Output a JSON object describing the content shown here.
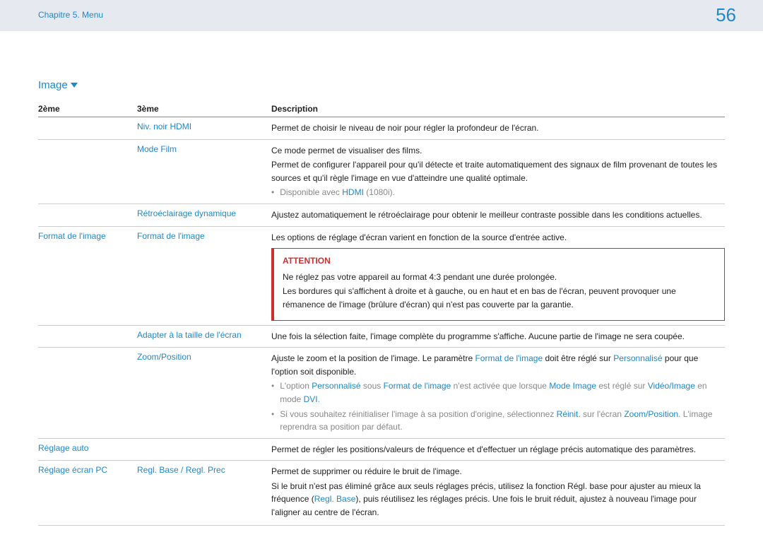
{
  "header": {
    "chapter": "Chapitre 5. Menu",
    "page": "56"
  },
  "section": {
    "title": "Image"
  },
  "table": {
    "headers": {
      "col2": "2ème",
      "col3": "3ème",
      "desc": "Description"
    }
  },
  "rows": {
    "r1": {
      "col3": "Niv. noir HDMI",
      "desc": "Permet de choisir le niveau de noir pour régler la profondeur de l'écran."
    },
    "r2": {
      "col3": "Mode Film",
      "p1": "Ce mode permet de visualiser des films.",
      "p2": "Permet de configurer l'appareil pour qu'il détecte et traite automatiquement des signaux de film provenant de toutes les sources et qu'il règle l'image en vue d'atteindre une qualité optimale.",
      "bullet_pre": "Disponible avec ",
      "bullet_link": "HDMI",
      "bullet_post": " (1080i)."
    },
    "r3": {
      "col3": "Rétroéclairage dynamique",
      "desc": "Ajustez automatiquement le rétroéclairage pour obtenir le meilleur contraste possible dans les conditions actuelles."
    },
    "r4": {
      "col2": "Format de l'image",
      "col3": "Format de l'image",
      "p1": "Les options de réglage d'écran varient en fonction de la source d'entrée active.",
      "attention": {
        "title": "ATTENTION",
        "l1": "Ne réglez pas votre appareil au format 4:3 pendant une durée prolongée.",
        "l2": "Les bordures qui s'affichent à droite et à gauche, ou en haut et en bas de l'écran, peuvent provoquer une rémanence de l'image (brûlure d'écran) qui n'est pas couverte par la garantie."
      }
    },
    "r5": {
      "col3": "Adapter à la taille de l'écran",
      "desc": "Une fois la sélection faite, l'image complète du programme s'affiche. Aucune partie de l'image ne sera coupée."
    },
    "r6": {
      "col3": "Zoom/Position",
      "p1a": "Ajuste le zoom et la position de l'image. Le paramètre ",
      "p1b": "Format de l'image",
      "p1c": " doit être réglé sur ",
      "p1d": "Personnalisé",
      "p1e": " pour que l'option soit disponible.",
      "b1a": "L'option ",
      "b1b": "Personnalisé",
      "b1c": " sous ",
      "b1d": "Format de l'image",
      "b1e": " n'est activée que lorsque ",
      "b1f": "Mode Image",
      "b1g": " est réglé sur ",
      "b1h": "Vidéo/Image",
      "b1i": " en mode ",
      "b1j": "DVI",
      "b1k": ".",
      "b2a": "Si vous souhaitez réinitialiser l'image à sa position d'origine, sélectionnez ",
      "b2b": "Réinit.",
      "b2c": " sur l'écran ",
      "b2d": "Zoom/Position",
      "b2e": ". L'image reprendra sa position par défaut."
    },
    "r7": {
      "col2": "Réglage auto",
      "desc": "Permet de régler les positions/valeurs de fréquence et d'effectuer un réglage précis automatique des paramètres."
    },
    "r8": {
      "col2": "Réglage écran PC",
      "col3": "Regl. Base / Regl. Prec",
      "p1": "Permet de supprimer ou réduire le bruit de l'image.",
      "p2a": "Si le bruit n'est pas éliminé grâce aux seuls réglages précis, utilisez la fonction Régl. base pour ajuster au mieux la fréquence (",
      "p2b": "Regl. Base",
      "p2c": "), puis réutilisez les réglages précis. Une fois le bruit réduit, ajustez à nouveau l'image pour l'aligner au centre de l'écran."
    }
  }
}
